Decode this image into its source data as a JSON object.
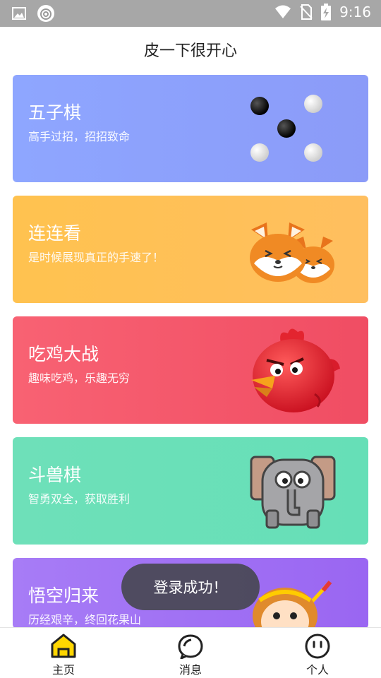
{
  "status_bar": {
    "time": "9:16"
  },
  "header": {
    "title": "皮一下很开心"
  },
  "cards": [
    {
      "title": "五子棋",
      "subtitle": "高手过招，招招致命"
    },
    {
      "title": "连连看",
      "subtitle": "是时候展现真正的手速了！"
    },
    {
      "title": "吃鸡大战",
      "subtitle": "趣味吃鸡，乐趣无穷"
    },
    {
      "title": "斗兽棋",
      "subtitle": "智勇双全，获取胜利"
    },
    {
      "title": "悟空归来",
      "subtitle": "历经艰辛，终回花果山"
    }
  ],
  "toast": {
    "text": "登录成功！"
  },
  "bottom_nav": [
    {
      "label": "主页",
      "icon": "home-icon",
      "active": true
    },
    {
      "label": "消息",
      "icon": "message-icon",
      "active": false
    },
    {
      "label": "个人",
      "icon": "profile-icon",
      "active": false
    }
  ],
  "colors": {
    "accent_active": "#ffd600",
    "gomoku_card": "#8ea6ff",
    "link_card": "#ffc24f",
    "chicken_card": "#f86273",
    "animal_chess_card": "#6ee0b9",
    "wukong_card": "#a77cf6"
  }
}
